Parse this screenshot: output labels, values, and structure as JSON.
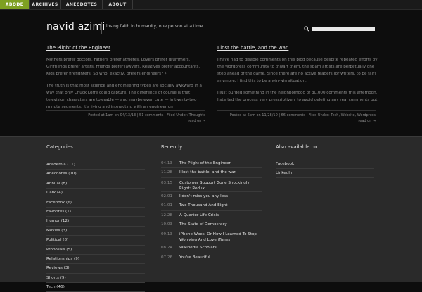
{
  "nav": {
    "tabs": [
      {
        "label": "ABODE",
        "active": true
      },
      {
        "label": "ARCHIVES",
        "active": false
      },
      {
        "label": "ANECDOTES",
        "active": false
      },
      {
        "label": "ABOUT",
        "active": false
      }
    ]
  },
  "header": {
    "title": "navid azimi",
    "tagline": "losing faith in humanity, one person at a time",
    "search_icon": "search-icon",
    "search_value": ""
  },
  "posts": [
    {
      "title": "The Plight of the Engineer",
      "paragraphs": [
        "Mothers prefer doctors. Fathers prefer athletes. Lovers prefer drummers. Girlfriends prefer artists. Friends prefer lawyers. Relatives prefer accountants. Kids prefer firefighters. So who, exactly, prefers engineers? ♯",
        "The truth is that most science and engineering types are socially awkward in a way that only Chuck Lorre could capture. The difference of course is that television characters are tolerable — and maybe even cute — in twenty-two minute segments. It's living and interacting with an engineer on"
      ],
      "meta": "Posted at 1am on 04/13/13 | 51 comments | Filed Under: Thoughts",
      "read_on": "read on ⤳"
    },
    {
      "title": "I lost the battle, and the war.",
      "paragraphs": [
        "I have had to disable comments on this blog because despite repeated efforts by the Wordpress community to thwart them, the spam artists are perpetually one step ahead of the game. Since there are no active readers (or writers, to be fair) anymore, I find this to be a win-win situation.",
        "I just purged something in the neighborhood of 30,000 comments this afternoon. I started the process very prescriptively to avoid deleting any real comments but"
      ],
      "meta": "Posted at 6pm on 11/28/10 | 66 comments | Filed Under: Tech, Website, Wordpress",
      "read_on": "read on ⤳"
    }
  ],
  "footer": {
    "categories_heading": "Categories",
    "categories": [
      "Academia (11)",
      "Anecdotes (10)",
      "Annual (8)",
      "Dark (4)",
      "Facebook (6)",
      "Favorites (1)",
      "Humor (12)",
      "Movies (3)",
      "Political (8)",
      "Proposals (5)",
      "Relationships (9)",
      "Reviews (3)",
      "Shorts (9)",
      "Tech (46)"
    ],
    "recently_heading": "Recently",
    "recent": [
      {
        "date": "04.13",
        "title": "The Plight of the Engineer"
      },
      {
        "date": "11.28",
        "title": "I lost the battle, and the war."
      },
      {
        "date": "03.15",
        "title": "Customer Support Gone Shockingly Right: Redux"
      },
      {
        "date": "02.01",
        "title": "I don't miss you any less"
      },
      {
        "date": "01.01",
        "title": "Two Thousand And Eight"
      },
      {
        "date": "12.28",
        "title": "A Quarter Life Crisis"
      },
      {
        "date": "10.03",
        "title": "The State of Democracy"
      },
      {
        "date": "09.13",
        "title": "iPhone Woes: Or How I Learned To Stop Worrying And Love iTunes"
      },
      {
        "date": "08.24",
        "title": "Wikipedia Scholars"
      },
      {
        "date": "07.26",
        "title": "You're Beautiful"
      }
    ],
    "available_heading": "Also available on",
    "available": [
      "Facebook",
      "LinkedIn"
    ]
  },
  "colors": {
    "accent": "#7ea022",
    "background": "#0d0d0d",
    "footer": "#2a2a2a"
  }
}
